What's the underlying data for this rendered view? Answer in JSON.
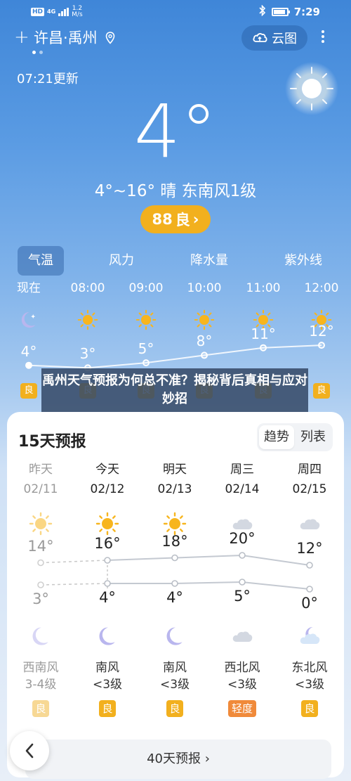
{
  "status_bar": {
    "network_badge": "HD",
    "network_type": "4G",
    "speed_value": "1.2",
    "speed_unit": "M/s",
    "time": "7:29"
  },
  "header": {
    "add_label": "+",
    "location": "许昌·禹州",
    "cloud_map_label": "云图",
    "page_dots": 2,
    "active_dot": 0
  },
  "now": {
    "updated": "07:21更新",
    "temp": "4°",
    "description": "4°~16° 晴 东南风1级",
    "aqi_value": "88",
    "aqi_level": "良",
    "aqi_chevron": "›"
  },
  "tabs": [
    {
      "label": "气温",
      "active": true
    },
    {
      "label": "风力",
      "active": false
    },
    {
      "label": "降水量",
      "active": false
    },
    {
      "label": "紫外线",
      "active": false
    }
  ],
  "hourly": [
    {
      "time": "现在",
      "icon": "moon-icon",
      "temp": "4°",
      "temp_value": 4,
      "aqi": "良"
    },
    {
      "time": "08:00",
      "icon": "sun-icon",
      "temp": "3°",
      "temp_value": 3,
      "aqi": "良"
    },
    {
      "time": "09:00",
      "icon": "sun-icon",
      "temp": "5°",
      "temp_value": 5,
      "aqi": "良"
    },
    {
      "time": "10:00",
      "icon": "sun-icon",
      "temp": "8°",
      "temp_value": 8,
      "aqi": "良"
    },
    {
      "time": "11:00",
      "icon": "sun-icon",
      "temp": "11°",
      "temp_value": 11,
      "aqi": "良"
    },
    {
      "time": "12:00",
      "icon": "sun-icon",
      "temp": "12°",
      "temp_value": 12,
      "aqi": "良"
    }
  ],
  "headline": "禹州天气预报为何总不准？揭秘背后真相与应对妙招",
  "forecast": {
    "title": "15天预报",
    "toggle_trend": "趋势",
    "toggle_list": "列表",
    "days": [
      {
        "name": "昨天",
        "date": "02/11",
        "day_icon": "sun-icon",
        "hi": "14°",
        "hi_value": 14,
        "lo": "3°",
        "lo_value": 3,
        "night_icon": "moon-icon",
        "wind_dir": "西南风",
        "wind_level": "3-4级",
        "aqi": "良",
        "aqi_color": "#f7d894",
        "past": true
      },
      {
        "name": "今天",
        "date": "02/12",
        "day_icon": "sun-icon",
        "hi": "16°",
        "hi_value": 16,
        "lo": "4°",
        "lo_value": 4,
        "night_icon": "moon-icon",
        "wind_dir": "南风",
        "wind_level": "<3级",
        "aqi": "良",
        "aqi_color": "#f2b01e",
        "past": false
      },
      {
        "name": "明天",
        "date": "02/13",
        "day_icon": "sun-icon",
        "hi": "18°",
        "hi_value": 18,
        "lo": "4°",
        "lo_value": 4,
        "night_icon": "moon-icon",
        "wind_dir": "南风",
        "wind_level": "<3级",
        "aqi": "良",
        "aqi_color": "#f2b01e",
        "past": false
      },
      {
        "name": "周三",
        "date": "02/14",
        "day_icon": "cloud-icon",
        "hi": "20°",
        "hi_value": 20,
        "lo": "5°",
        "lo_value": 5,
        "night_icon": "cloud-icon",
        "wind_dir": "西北风",
        "wind_level": "<3级",
        "aqi": "轻度",
        "aqi_color": "#f08a3a",
        "past": false
      },
      {
        "name": "周四",
        "date": "02/15",
        "day_icon": "cloud-icon",
        "hi": "12°",
        "hi_value": 12,
        "lo": "0°",
        "lo_value": 0,
        "night_icon": "cloud-moon-icon",
        "wind_dir": "东北风",
        "wind_level": "<3级",
        "aqi": "良",
        "aqi_color": "#f2b01e",
        "past": false
      }
    ],
    "forty_day_label": "40天预报 ›"
  },
  "colors": {
    "aqi_good": "#f2b01e",
    "aqi_light": "#f08a3a",
    "sky_top": "#3f86d8"
  }
}
